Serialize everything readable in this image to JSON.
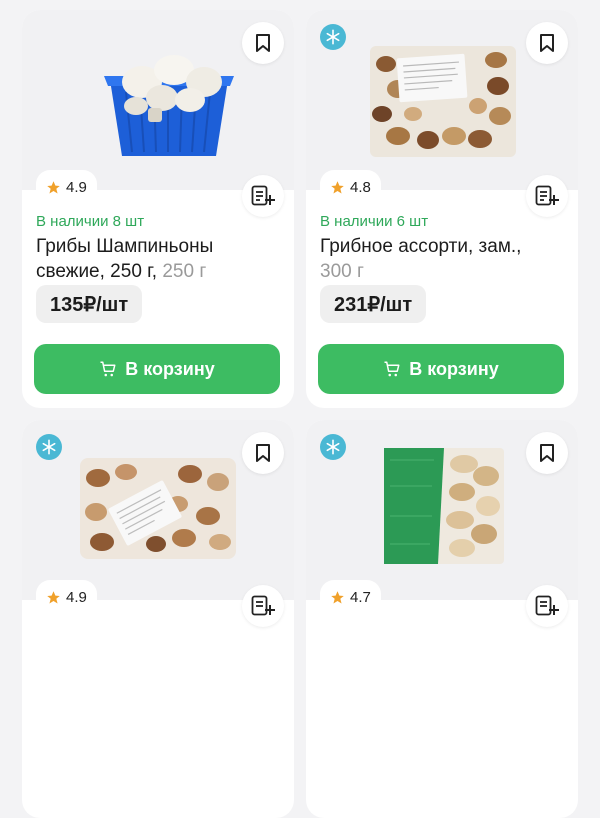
{
  "products": [
    {
      "rating": "4.9",
      "stock": "В наличии 8 шт",
      "title": "Грибы Шампиньоны свежие, 250 г,",
      "weight": "250 г",
      "price": "135₽/шт",
      "cart_label": "В корзину",
      "frozen": false
    },
    {
      "rating": "4.8",
      "stock": "В наличии 6 шт",
      "title": "Грибное ассорти, зам.,",
      "weight": "300 г",
      "price": "231₽/шт",
      "cart_label": "В корзину",
      "frozen": true
    },
    {
      "rating": "4.9",
      "frozen": true
    },
    {
      "rating": "4.7",
      "frozen": true
    }
  ],
  "colors": {
    "accent_green": "#3dbc62",
    "stock_green": "#2fa85a",
    "frozen_badge": "#4ab8d4",
    "star": "#f0a12b"
  },
  "icons": {
    "bookmark": "bookmark-icon",
    "snowflake": "snowflake-icon",
    "star": "star-icon",
    "list_add": "list-add-icon",
    "cart": "cart-icon"
  }
}
